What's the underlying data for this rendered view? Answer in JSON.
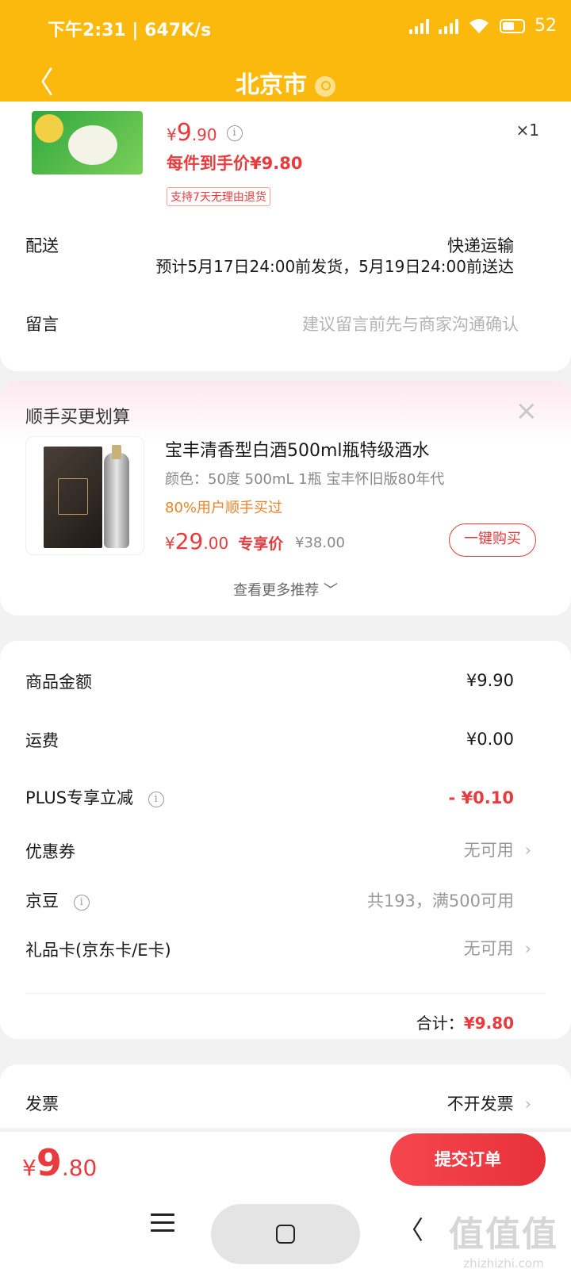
{
  "status_bar": {
    "time": "下午2:31 | 647K/s",
    "battery": "52"
  },
  "header": {
    "title": "北京市"
  },
  "product": {
    "currency": "¥",
    "price_int": "9",
    "price_dec": ".90",
    "quantity": "×1",
    "per_item_price": "每件到手价¥9.80",
    "return_tag": "支持7天无理由退货"
  },
  "delivery": {
    "label": "配送",
    "mode": "快递运输",
    "estimate": "预计5月17日24:00前发货，5月19日24:00前送达"
  },
  "memo": {
    "label": "留言",
    "placeholder": "建议留言前先与商家沟通确认"
  },
  "recommend": {
    "title": "顺手买更划算",
    "close": "×",
    "item": {
      "name": "宝丰清香型白酒500ml瓶特级酒水",
      "spec": "颜色：50度 500mL 1瓶 宝丰怀旧版80年代",
      "users": "80%用户顺手买过",
      "currency": "¥",
      "price_int": "29",
      "price_dec": ".00",
      "exclusive": "专享价",
      "original_price": "¥38.00",
      "buy_label": "一键购买"
    },
    "more": "查看更多推荐 ﹀"
  },
  "summary": {
    "rows": [
      {
        "label": "商品金额",
        "value": "¥9.90"
      },
      {
        "label": "运费",
        "value": "¥0.00"
      },
      {
        "label": "PLUS专享立减",
        "value": "- ¥0.10"
      },
      {
        "label": "优惠券",
        "value": "无可用"
      },
      {
        "label": "京豆",
        "value": "共193，满500可用"
      },
      {
        "label": "礼品卡(京东卡/E卡)",
        "value": "无可用"
      }
    ],
    "total_label": "合计：",
    "total_value": "¥9.80"
  },
  "invoice": {
    "label": "发票",
    "value": "不开发票"
  },
  "bottom": {
    "currency": "¥",
    "price_int": "9",
    "price_dec": ".80",
    "submit_label": "提交订单"
  },
  "watermark": {
    "mark": "值值值",
    "url": "zhizhizhi.com"
  },
  "colors": {
    "brand_yellow": "#fbb80d",
    "price_red": "#e93b3d",
    "hint_orange": "#e8842a"
  }
}
